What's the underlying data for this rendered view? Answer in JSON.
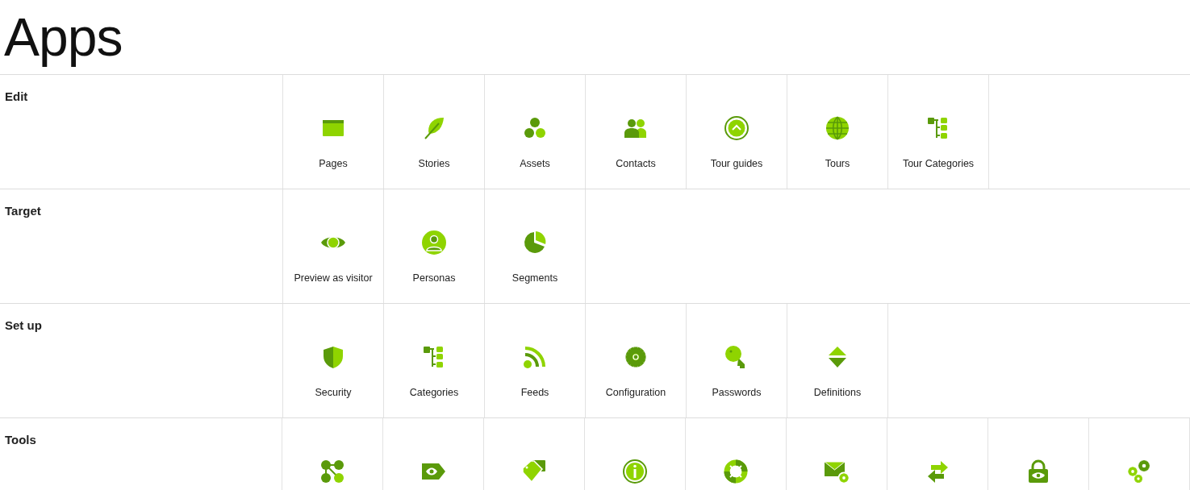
{
  "title": "Apps",
  "sections": [
    {
      "title": "Edit",
      "apps": [
        {
          "label": "Pages"
        },
        {
          "label": "Stories"
        },
        {
          "label": "Assets"
        },
        {
          "label": "Contacts"
        },
        {
          "label": "Tour guides"
        },
        {
          "label": "Tours"
        },
        {
          "label": "Tour Categories"
        }
      ]
    },
    {
      "title": "Target",
      "apps": [
        {
          "label": "Preview as visitor"
        },
        {
          "label": "Personas"
        },
        {
          "label": "Segments"
        }
      ]
    },
    {
      "title": "Set up",
      "apps": [
        {
          "label": "Security"
        },
        {
          "label": "Categories"
        },
        {
          "label": "Feeds"
        },
        {
          "label": "Configuration"
        },
        {
          "label": "Passwords"
        },
        {
          "label": "Definitions"
        }
      ]
    },
    {
      "title": "Tools",
      "apps": [
        {
          "kind": "icon"
        },
        {
          "kind": "icon"
        },
        {
          "kind": "icon"
        },
        {
          "kind": "icon"
        },
        {
          "kind": "icon"
        },
        {
          "kind": "icon"
        },
        {
          "kind": "icon"
        },
        {
          "kind": "icon"
        },
        {
          "kind": "icon"
        }
      ]
    }
  ]
}
